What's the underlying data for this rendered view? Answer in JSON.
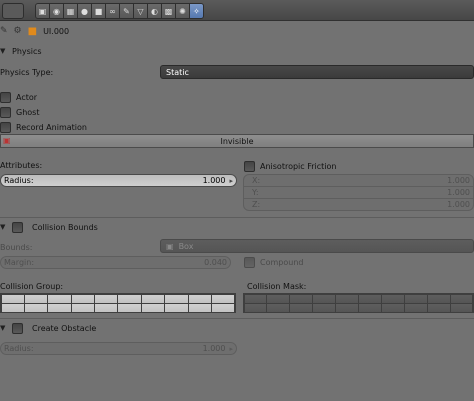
{
  "header": {
    "tabs": [
      {
        "icon": "camera-icon",
        "glyph": "▣"
      },
      {
        "icon": "world-icon",
        "glyph": "◉"
      },
      {
        "icon": "object-icon",
        "glyph": "▦"
      },
      {
        "icon": "globe-icon",
        "glyph": "●"
      },
      {
        "icon": "cube-icon",
        "glyph": "■"
      },
      {
        "icon": "link-icon",
        "glyph": "∞"
      },
      {
        "icon": "wrench-icon",
        "glyph": "✎"
      },
      {
        "icon": "triangle-icon",
        "glyph": "▽"
      },
      {
        "icon": "sphere-icon",
        "glyph": "◐"
      },
      {
        "icon": "checker-icon",
        "glyph": "▩"
      },
      {
        "icon": "sparkle-icon",
        "glyph": "✺"
      },
      {
        "icon": "physics-icon",
        "glyph": "✧",
        "active": true
      }
    ]
  },
  "breadcrumb": {
    "object_name": "UI.000"
  },
  "physics": {
    "title": "Physics",
    "type_label": "Physics Type:",
    "type_value": "Static",
    "actor_label": "Actor",
    "ghost_label": "Ghost",
    "record_label": "Record Animation",
    "invisible_label": "Invisible",
    "attributes_label": "Attributes:",
    "radius_label": "Radius:",
    "radius_value": "1.000",
    "aniso_label": "Anisotropic Friction",
    "x_label": "X:",
    "x_value": "1.000",
    "y_label": "Y:",
    "y_value": "1.000",
    "z_label": "Z:",
    "z_value": "1.000"
  },
  "collision_bounds": {
    "title": "Collision Bounds",
    "bounds_label": "Bounds:",
    "bounds_value": "Box",
    "margin_label": "Margin:",
    "margin_value": "0.040",
    "compound_label": "Compound",
    "group_label": "Collision Group:",
    "mask_label": "Collision Mask:"
  },
  "create_obstacle": {
    "title": "Create Obstacle",
    "radius_label": "Radius:",
    "radius_value": "1.000"
  },
  "colors": {
    "panel_bg": "#727272",
    "accent": "#5679b0"
  }
}
